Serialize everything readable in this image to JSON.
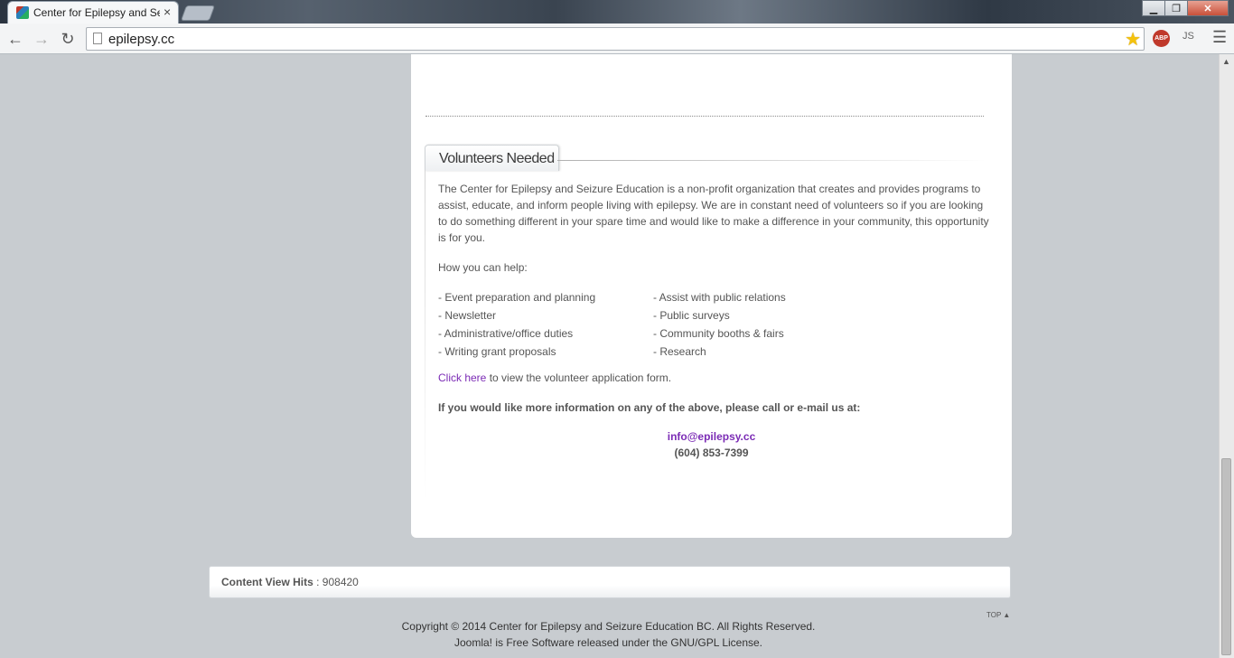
{
  "browser": {
    "tab_title": "Center for Epilepsy and Se",
    "tab_close": "×",
    "url": "epilepsy.cc",
    "back": "←",
    "forward": "→",
    "reload": "↻",
    "star": "★",
    "abp": "ABP",
    "js": "JS",
    "menu": "☰",
    "win_minimize": "▁",
    "win_maximize": "❐",
    "win_close": "✕"
  },
  "module": {
    "title": "Volunteers Needed",
    "intro": "The Center for Epilepsy and Seizure Education is a non-profit organization that creates and provides programs to assist, educate, and inform people living with epilepsy. We are in constant need of volunteers so if you are looking to do something different in your spare time and would like to make a difference in your community, this opportunity is for you.",
    "help_title": "How you can help:",
    "help_left": [
      "- Event preparation and planning",
      "- Newsletter",
      "- Administrative/office duties",
      "- Writing grant proposals"
    ],
    "help_right": [
      "- Assist with public relations",
      "- Public surveys",
      "- Community booths & fairs",
      "- Research"
    ],
    "click_link": "Click here",
    "click_rest": " to view the volunteer application form.",
    "more_info": "If you would like more information on any of the above, please call or e-mail us at:",
    "email": "info@epilepsy.cc",
    "phone": "(604) 853-7399"
  },
  "footer": {
    "hits_label": "Content View Hits",
    "hits_value": " : 908420",
    "top_link": "TOP ▲",
    "copyright_1": "Copyright © 2014 Center for Epilepsy and Seizure Education BC. All Rights Reserved.",
    "copyright_2": "Joomla! is Free Software released under the GNU/GPL License."
  }
}
